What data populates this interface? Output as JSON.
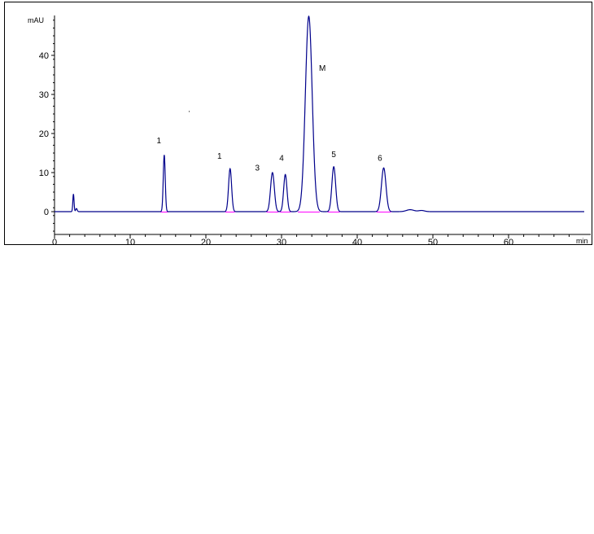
{
  "chart_data": {
    "type": "line",
    "title": "",
    "xlabel": "",
    "ylabel": "",
    "x_unit": "min",
    "y_unit": "mAU",
    "xlim": [
      0,
      70
    ],
    "ylim": [
      -5,
      50
    ],
    "x_ticks": [
      0,
      10,
      20,
      30,
      40,
      50,
      60
    ],
    "y_ticks": [
      0,
      10,
      20,
      30,
      40
    ],
    "grid": false,
    "colors": {
      "trace": "#00008b",
      "baseline": "#ff00ff",
      "axis": "#000000"
    },
    "baseline_value": 0,
    "peaks": [
      {
        "rt": 2.5,
        "height": 4.5,
        "width": 0.08,
        "label": ""
      },
      {
        "rt": 2.9,
        "height": 0.8,
        "width": 0.1,
        "label": ""
      },
      {
        "rt": 14.5,
        "height": 14.5,
        "width": 0.13,
        "label": "1"
      },
      {
        "rt": 23.2,
        "height": 11.0,
        "width": 0.2,
        "label": "1"
      },
      {
        "rt": 28.8,
        "height": 10.0,
        "width": 0.25,
        "label": "3"
      },
      {
        "rt": 30.5,
        "height": 9.5,
        "width": 0.22,
        "label": "4"
      },
      {
        "rt": 33.6,
        "height": 50.0,
        "width": 0.45,
        "label": "M"
      },
      {
        "rt": 36.9,
        "height": 11.5,
        "width": 0.25,
        "label": "5"
      },
      {
        "rt": 43.5,
        "height": 11.2,
        "width": 0.3,
        "label": "6"
      },
      {
        "rt": 47.0,
        "height": 0.5,
        "width": 0.5,
        "label": ""
      },
      {
        "rt": 48.5,
        "height": 0.3,
        "width": 0.4,
        "label": ""
      }
    ],
    "annotations": [
      {
        "text": "1",
        "x": 13.8,
        "y": 17.5
      },
      {
        "text": "1",
        "x": 21.8,
        "y": 13.5
      },
      {
        "text": "3",
        "x": 26.8,
        "y": 10.5
      },
      {
        "text": "4",
        "x": 30.0,
        "y": 13.0
      },
      {
        "text": "M",
        "x": 35.4,
        "y": 36.0
      },
      {
        "text": "5",
        "x": 36.9,
        "y": 14.0
      },
      {
        "text": "6",
        "x": 43.0,
        "y": 13.0
      },
      {
        "text": ".",
        "x": 17.8,
        "y": 25.5
      }
    ]
  }
}
